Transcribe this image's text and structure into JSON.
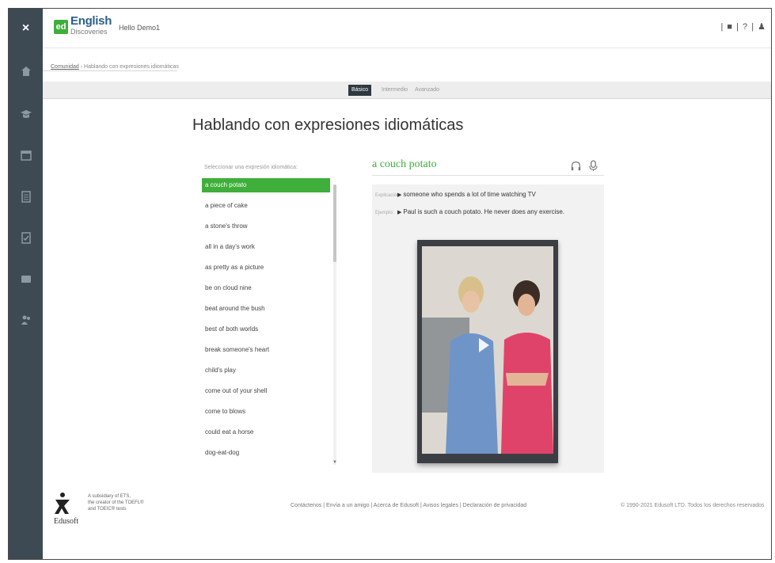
{
  "header": {
    "logo_badge": "ed",
    "logo_title": "English",
    "logo_subtitle": "Discoveries",
    "greeting": "Hello Demo1",
    "right_icons": "| ■ | ? | ♟"
  },
  "sidebar": {
    "close_label": "×",
    "items": [
      "home-icon",
      "education-icon",
      "calendar-icon",
      "clipboard-icon",
      "assessment-icon",
      "message-icon",
      "community-icon"
    ]
  },
  "breadcrumb": {
    "link": "Comunidad",
    "separator": " › ",
    "current": "Hablando con expresiones idiomáticas"
  },
  "tabs": [
    {
      "label": "Básico",
      "active": true
    },
    {
      "label": "Intermedio",
      "active": false
    },
    {
      "label": "Avanzado",
      "active": false
    }
  ],
  "page_title": "Hablando con expresiones idiomáticas",
  "list": {
    "label": "Seleccionar una expresión idiomática:",
    "items": [
      "a couch potato",
      "a piece of cake",
      "a stone's throw",
      "all in a day's work",
      "as pretty as a picture",
      "be on cloud nine",
      "beat around the bush",
      "best of both worlds",
      "break someone's heart",
      "child's play",
      "come out of your shell",
      "come to blows",
      "could eat a horse",
      "dog-eat-dog"
    ],
    "selected_index": 0
  },
  "detail": {
    "title": "a couch potato",
    "explanation_label": "Explicación:",
    "explanation": "someone who spends a lot of time watching TV",
    "example_label": "Ejemplo:",
    "example": "Paul is such a couch potato. He never does any exercise."
  },
  "footer": {
    "brand": "Edusoft",
    "sub_lines": [
      "A subsidiary of ETS,",
      "the creator of the TOEFL®",
      "and TOEIC® tests"
    ],
    "links": "Contáctenos | Envía a un amigo | Acerca de Edusoft | Avisos legales | Declaración de privacidad",
    "copyright": "© 1990-2021 Edusoft LTD. Todos los derechos reservados"
  },
  "colors": {
    "accent": "#3fae3b",
    "sidebar": "#3d4a54",
    "active_tab": "#2f3840"
  }
}
